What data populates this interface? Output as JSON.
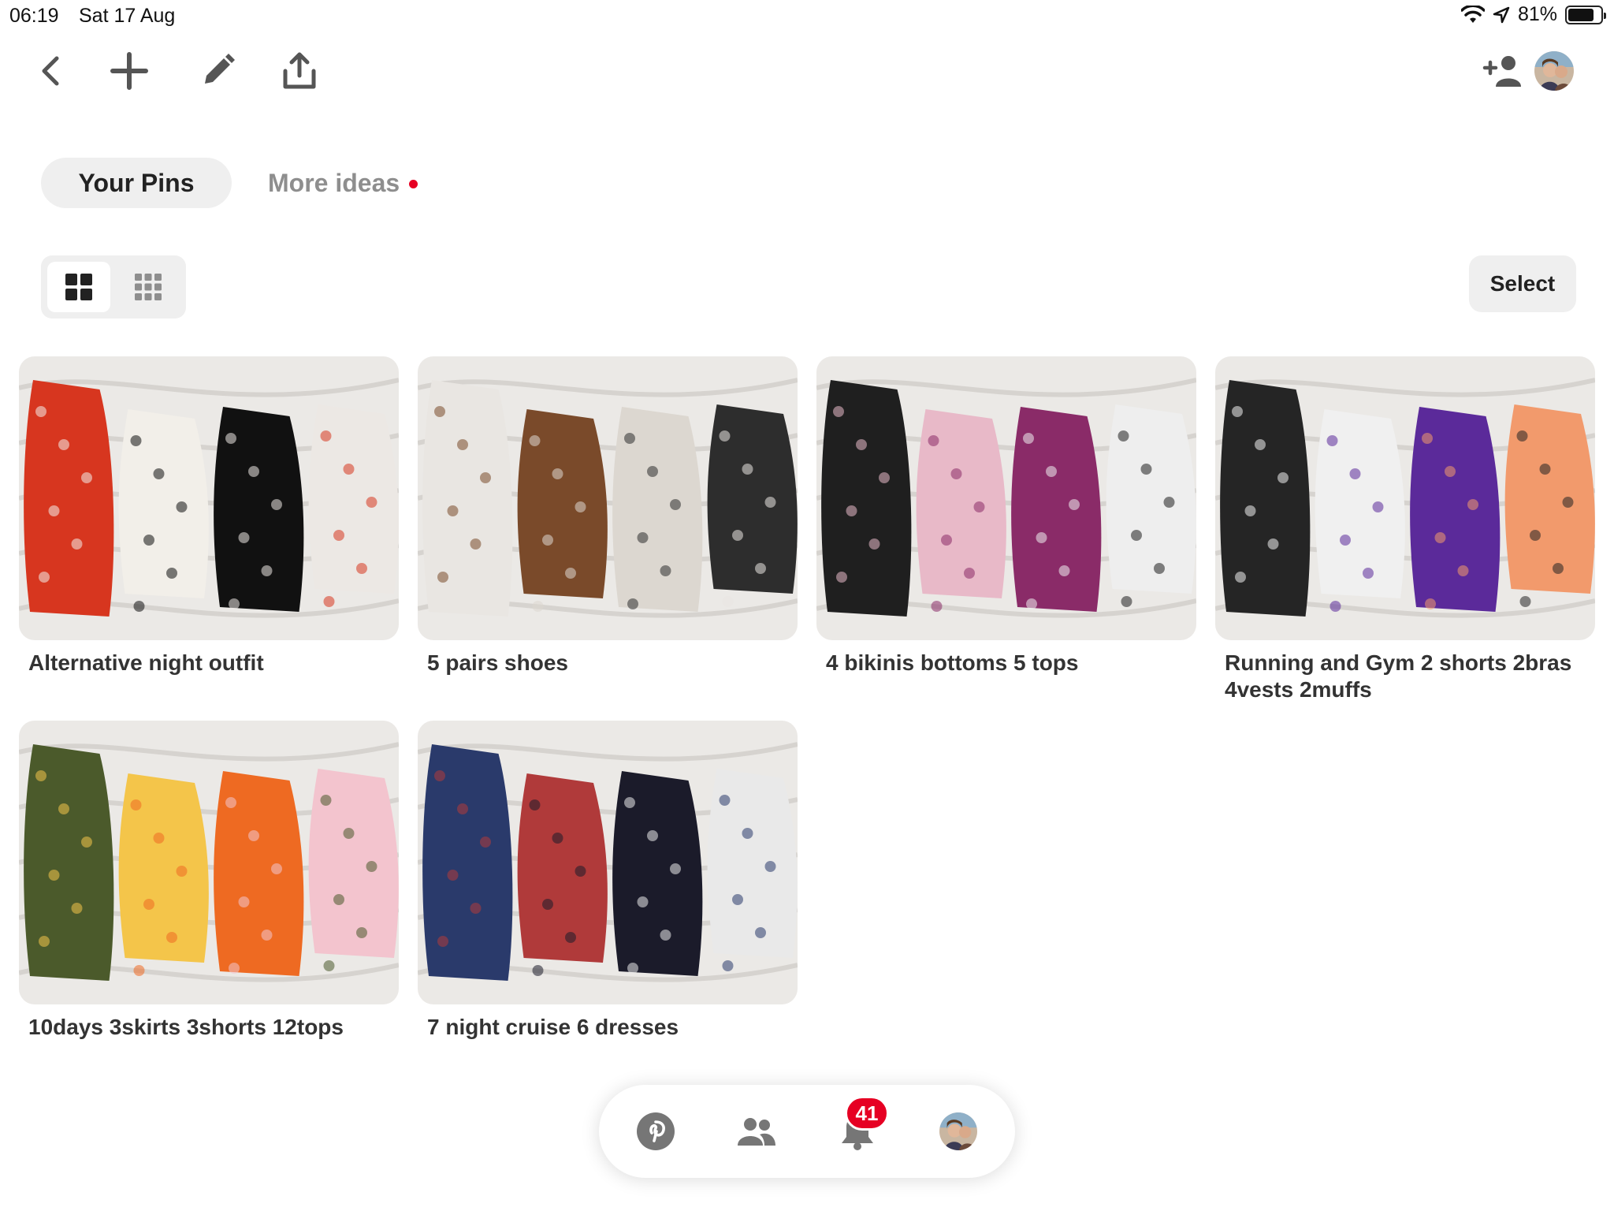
{
  "status_bar": {
    "time": "06:19",
    "date": "Sat 17 Aug",
    "battery_label": "81%",
    "battery_level": 0.81
  },
  "toolbar": {
    "back_icon": "chevron-left-icon",
    "add_icon": "plus-icon",
    "edit_icon": "pencil-icon",
    "share_icon": "share-icon",
    "invite_icon": "add-collaborator-icon",
    "avatar_icon": "profile-avatar"
  },
  "tabs": [
    {
      "label": "Your Pins",
      "active": true
    },
    {
      "label": "More ideas",
      "active": false,
      "has_notification_dot": true
    }
  ],
  "view_toggle": {
    "options": [
      "standard-grid-icon",
      "compact-grid-icon"
    ],
    "selected": "standard-grid-icon"
  },
  "select_button": {
    "label": "Select"
  },
  "pins": [
    {
      "title": "Alternative night outfit",
      "colors": [
        "#d7361f",
        "#f2efe9",
        "#111111",
        "#ece8e4"
      ]
    },
    {
      "title": "5 pairs shoes",
      "colors": [
        "#e9e6e2",
        "#7a4a2a",
        "#dcd7d0",
        "#2d2d2d"
      ]
    },
    {
      "title": "4 bikinis bottoms 5 tops",
      "colors": [
        "#1f1f1f",
        "#e8b9c8",
        "#8a2b68",
        "#eeeeee"
      ]
    },
    {
      "title": "Running and Gym 2 shorts 2bras 4vests 2muffs",
      "colors": [
        "#252525",
        "#f0f0f0",
        "#5b2a9a",
        "#f29a6c"
      ]
    },
    {
      "title": "10days 3skirts 3shorts 12tops",
      "colors": [
        "#4b5a2b",
        "#f4c54a",
        "#ee6a22",
        "#f3c4ce"
      ]
    },
    {
      "title": "7 night cruise 6 dresses",
      "colors": [
        "#2a3a6b",
        "#b03a3a",
        "#1b1b2a",
        "#e9e9e9"
      ]
    }
  ],
  "bottom_nav": {
    "items": [
      "pinterest-logo-icon",
      "people-icon",
      "bell-icon",
      "profile-avatar"
    ],
    "notification_count": "41"
  }
}
